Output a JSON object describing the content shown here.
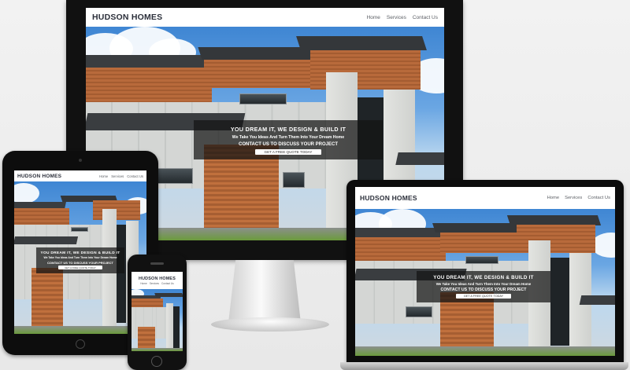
{
  "site": {
    "brand": "HUDSON HOMES",
    "nav": [
      "Home",
      "Services",
      "Contact Us"
    ],
    "hero": {
      "headline": "YOU DREAM IT, WE DESIGN & BUILD IT",
      "subline": "We Take You Ideas And Turn Them Into Your Dream Home",
      "cta_text": "CONTACT US TO DISCUSS YOUR PROJECT",
      "button": "GET A FREE QUOTE TODAY"
    }
  },
  "devices": [
    "desktop-monitor",
    "tablet",
    "laptop",
    "phone"
  ],
  "colors": {
    "navbar_bg": "#ffffff",
    "brand_text": "#2b2f3a",
    "hero_overlay": "#141414",
    "device_frame": "#111111",
    "sky": "#4a8fd6",
    "wood": "#b86a3b"
  }
}
